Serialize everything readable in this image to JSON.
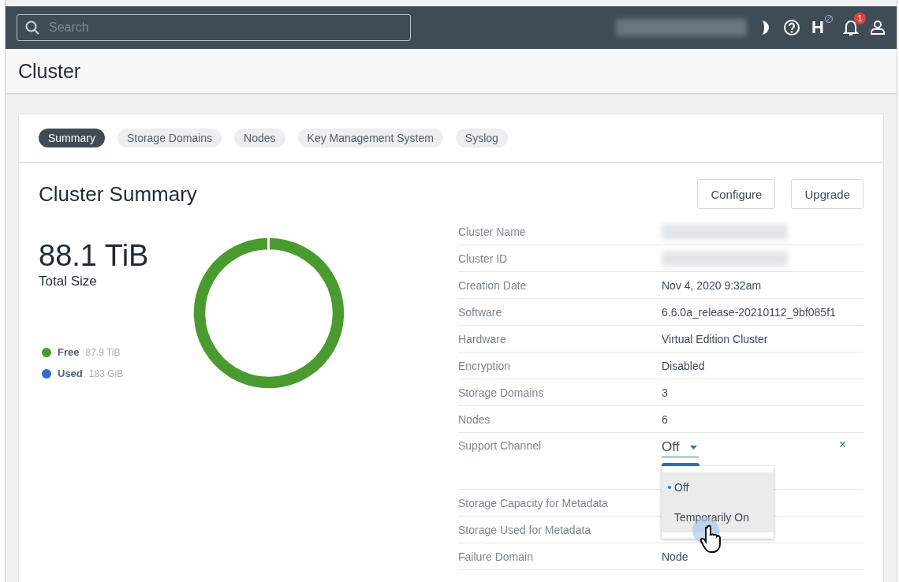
{
  "topbar": {
    "search": {
      "placeholder": "Search"
    },
    "help_letter": "H",
    "notifications": {
      "count": "1"
    }
  },
  "page": {
    "title": "Cluster"
  },
  "tabs": [
    {
      "label": "Summary",
      "selected": true
    },
    {
      "label": "Storage Domains",
      "selected": false
    },
    {
      "label": "Nodes",
      "selected": false
    },
    {
      "label": "Key Management System",
      "selected": false
    },
    {
      "label": "Syslog",
      "selected": false
    }
  ],
  "summary": {
    "title": "Cluster Summary",
    "buttons": [
      "Configure",
      "Upgrade"
    ],
    "total_size": "88.1 TiB",
    "total_label": "Total Size",
    "legend": [
      {
        "value": "87.9 TiB",
        "color": "#4a9b2f"
      },
      {
        "value": "183 GiB",
        "color": "#2f6fc6"
      }
    ],
    "chart_data": {
      "type": "donut",
      "categories": [
        "Free",
        "Used"
      ],
      "values": [
        99.8,
        0.2
      ]
    }
  },
  "details": [
    {
      "kind": "redacted",
      "label": "Cluster Name"
    },
    {
      "kind": "redacted",
      "label": "Cluster ID"
    },
    {
      "kind": "text",
      "label": "Creation Date",
      "value": "Nov 4, 2020 9:32am"
    },
    {
      "kind": "text",
      "label": "Software",
      "value": "6.6.0a_release-20210112_9bf085f1"
    },
    {
      "kind": "text",
      "label": "Hardware",
      "value": "Virtual Edition Cluster"
    },
    {
      "kind": "text",
      "label": "Encryption",
      "value": "Disabled"
    },
    {
      "kind": "text",
      "label": "Storage Domains",
      "value": "3"
    },
    {
      "kind": "text",
      "label": "Nodes",
      "value": "6"
    },
    {
      "kind": "select",
      "label": "Support Channel",
      "value": "Off",
      "close": "×",
      "options": [
        {
          "label": "Off",
          "selected": true
        },
        {
          "label": "Temporarily On",
          "selected": false
        }
      ]
    },
    {
      "kind": "covered",
      "label": "Storage Capacity for Metadata"
    },
    {
      "kind": "covered",
      "label": "Storage Used for Metadata"
    },
    {
      "kind": "text",
      "label": "Failure Domain",
      "value": "Node"
    }
  ]
}
